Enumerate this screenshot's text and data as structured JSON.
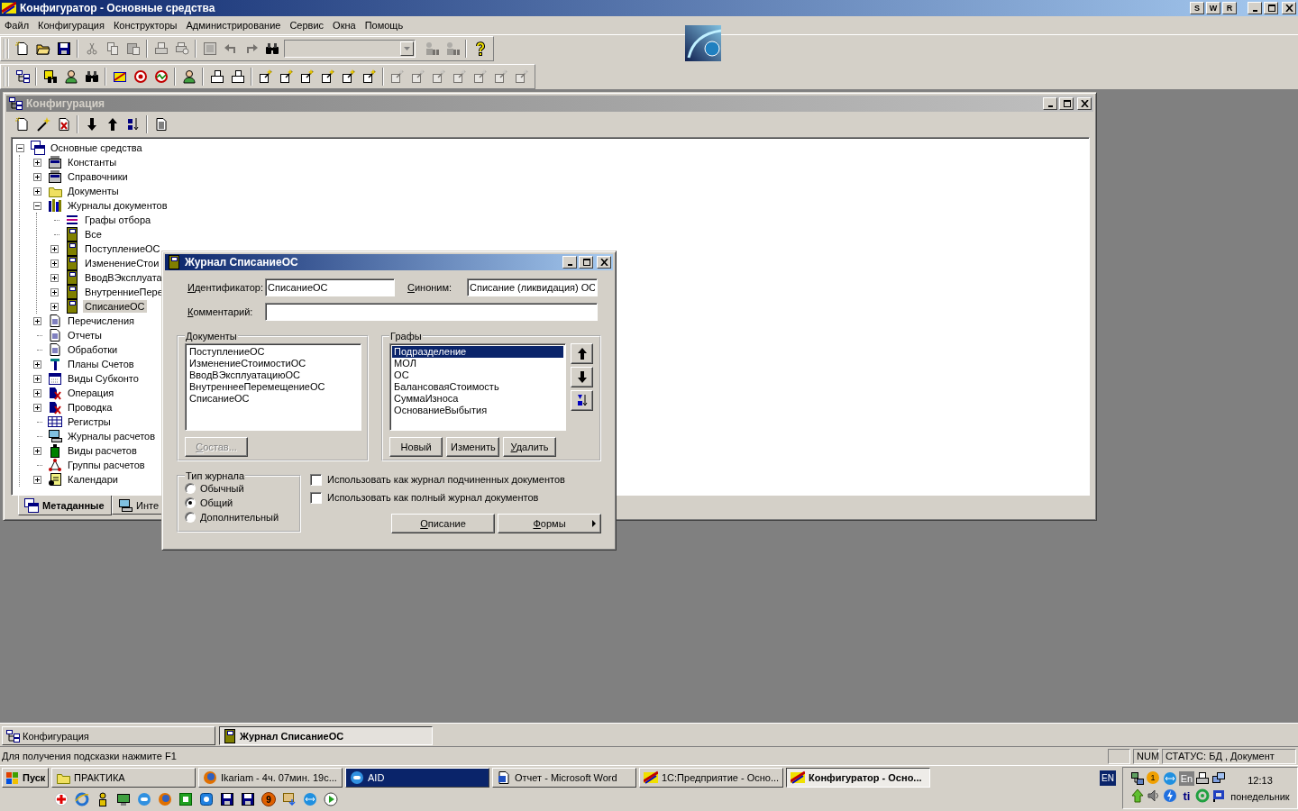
{
  "app_window": {
    "title": "Конфигуратор - Основные средства",
    "title_buttons": [
      "S",
      "W",
      "R"
    ]
  },
  "menu": [
    "Файл",
    "Конфигурация",
    "Конструкторы",
    "Администрирование",
    "Сервис",
    "Окна",
    "Помощь"
  ],
  "toolbar_rows": [
    [
      [
        {
          "kind": "button",
          "disabled": false
        },
        {
          "kind": "button",
          "disabled": false
        },
        {
          "kind": "button",
          "disabled": false
        }
      ],
      [
        {
          "kind": "button",
          "disabled": true
        },
        {
          "kind": "button",
          "disabled": true
        },
        {
          "kind": "button",
          "disabled": true
        }
      ],
      [
        {
          "kind": "button",
          "disabled": true
        },
        {
          "kind": "button",
          "disabled": true
        }
      ],
      [
        {
          "kind": "button",
          "disabled": true
        },
        {
          "kind": "button",
          "disabled": true
        },
        {
          "kind": "button",
          "disabled": true
        },
        {
          "kind": "button",
          "disabled": false
        },
        {
          "kind": "combo",
          "disabled": true
        },
        {
          "kind": "button",
          "disabled": true
        },
        {
          "kind": "button",
          "disabled": true
        }
      ],
      [
        {
          "kind": "button",
          "disabled": false
        }
      ]
    ],
    [
      [
        {
          "kind": "button",
          "disabled": false
        }
      ],
      [
        {
          "kind": "button",
          "disabled": false
        },
        {
          "kind": "button",
          "disabled": false
        },
        {
          "kind": "button",
          "disabled": false
        }
      ],
      [
        {
          "kind": "button",
          "disabled": false
        },
        {
          "kind": "button",
          "disabled": false
        },
        {
          "kind": "button",
          "disabled": false
        }
      ],
      [
        {
          "kind": "button",
          "disabled": false
        }
      ],
      [
        {
          "kind": "button",
          "disabled": false
        },
        {
          "kind": "button",
          "disabled": false
        }
      ],
      [
        {
          "kind": "button",
          "disabled": false
        },
        {
          "kind": "button",
          "disabled": false
        },
        {
          "kind": "button",
          "disabled": false
        },
        {
          "kind": "button",
          "disabled": false
        },
        {
          "kind": "button",
          "disabled": false
        },
        {
          "kind": "button",
          "disabled": false
        }
      ],
      [
        {
          "kind": "button",
          "disabled": true
        },
        {
          "kind": "button",
          "disabled": true
        },
        {
          "kind": "button",
          "disabled": true
        },
        {
          "kind": "button",
          "disabled": true
        },
        {
          "kind": "button",
          "disabled": true
        },
        {
          "kind": "button",
          "disabled": true
        },
        {
          "kind": "button",
          "disabled": true
        }
      ]
    ]
  ],
  "config_window": {
    "title": "Конфигурация",
    "active": false,
    "toolbar": [
      [
        {
          "disabled": false
        },
        {
          "disabled": false
        },
        {
          "disabled": false
        }
      ],
      [
        {
          "disabled": false
        },
        {
          "disabled": false
        },
        {
          "disabled": false
        }
      ],
      [
        {
          "disabled": false
        }
      ]
    ],
    "tree": [
      {
        "label": "Основные средства",
        "expanded": true,
        "selected": false,
        "children": [
          {
            "label": "Константы",
            "expanded": false,
            "selected": false
          },
          {
            "label": "Справочники",
            "expanded": false,
            "selected": false
          },
          {
            "label": "Документы",
            "expanded": false,
            "selected": false
          },
          {
            "label": "Журналы документов",
            "expanded": true,
            "selected": false,
            "children": [
              {
                "label": "Графы отбора",
                "selected": false
              },
              {
                "label": "Все",
                "selected": false
              },
              {
                "label": "ПоступлениеОС",
                "expanded": false,
                "selected": false
              },
              {
                "label": "ИзменениеСтои",
                "expanded": false,
                "selected": false
              },
              {
                "label": "ВводВЭксплуата",
                "expanded": false,
                "selected": false
              },
              {
                "label": "ВнутренниеПере",
                "expanded": false,
                "selected": false
              },
              {
                "label": "СписаниеОС",
                "expanded": false,
                "selected": true
              }
            ]
          },
          {
            "label": "Перечисления",
            "expanded": false,
            "selected": false
          },
          {
            "label": "Отчеты",
            "selected": false
          },
          {
            "label": "Обработки",
            "selected": false
          },
          {
            "label": "Планы Счетов",
            "expanded": false,
            "selected": false
          },
          {
            "label": "Виды Субконто",
            "expanded": false,
            "selected": false
          },
          {
            "label": "Операция",
            "expanded": false,
            "selected": false
          },
          {
            "label": "Проводка",
            "expanded": false,
            "selected": false
          },
          {
            "label": "Регистры",
            "selected": false
          },
          {
            "label": "Журналы расчетов",
            "selected": false
          },
          {
            "label": "Виды расчетов",
            "expanded": false,
            "selected": false
          },
          {
            "label": "Группы расчетов",
            "selected": false
          },
          {
            "label": "Календари",
            "expanded": false,
            "selected": false
          }
        ]
      }
    ],
    "tabs": [
      {
        "label": "Метаданные",
        "selected": true
      },
      {
        "label": "Инте",
        "selected": false
      }
    ]
  },
  "dialog": {
    "title": "Журнал СписаниеОС",
    "active": true,
    "identifier": {
      "label": "Идентификатор:",
      "value": "СписаниеОС"
    },
    "synonym": {
      "label": "Синоним:",
      "value": "Списание (ликвидация) ОС"
    },
    "comment": {
      "label": "Комментарий:"
    },
    "documents": {
      "title": "Документы",
      "items": [
        {
          "label": "ПоступлениеОС",
          "selected": false
        },
        {
          "label": "ИзменениеСтоимостиОС",
          "selected": false
        },
        {
          "label": "ВводВЭксплуатациюОС",
          "selected": false
        },
        {
          "label": "ВнутреннееПеремещениеОС",
          "selected": false
        },
        {
          "label": "СписаниеОС",
          "selected": false
        }
      ],
      "button": {
        "label": "Состав...",
        "disabled": true
      }
    },
    "columns": {
      "title": "Графы",
      "items": [
        {
          "label": "Подразделение",
          "selected": true
        },
        {
          "label": "МОЛ",
          "selected": false
        },
        {
          "label": "ОС",
          "selected": false
        },
        {
          "label": "БалансоваяСтоимость",
          "selected": false
        },
        {
          "label": "СуммаИзноса",
          "selected": false
        },
        {
          "label": "ОснованиеВыбытия",
          "selected": false
        }
      ],
      "buttons": [
        {
          "label": "Новый"
        },
        {
          "label": "Изменить"
        },
        {
          "label": "Удалить"
        }
      ]
    },
    "journal_type": {
      "title": "Тип журнала",
      "options": [
        {
          "label": "Обычный",
          "selected": false
        },
        {
          "label": "Общий",
          "selected": true
        },
        {
          "label": "Дополнительный",
          "selected": false
        }
      ]
    },
    "checkboxes": [
      {
        "label": "Использовать как журнал подчиненных документов",
        "checked": false
      },
      {
        "label": "Использовать как полный журнал  документов",
        "checked": false
      }
    ],
    "buttons": [
      {
        "label": "Описание",
        "menu": false
      },
      {
        "label": "Формы",
        "menu": true
      }
    ]
  },
  "mdi_tabs": [
    {
      "label": "Конфигурация",
      "selected": false
    },
    {
      "label": "Журнал СписаниеОС",
      "selected": true
    }
  ],
  "status_bar": {
    "hint": "Для получения подсказки нажмите F1",
    "panes": [
      "NUM",
      "СТАТУС: БД , Документ"
    ]
  },
  "taskbar": {
    "start": "Пуск",
    "tasks": [
      {
        "label": "ПРАКТИКА",
        "selected": false,
        "flashing": false
      },
      {
        "label": "Ikariam - 4ч. 07мин. 19с...",
        "selected": false,
        "flashing": false
      },
      {
        "label": "AID",
        "selected": false,
        "flashing": true
      },
      {
        "label": "Отчет - Microsoft Word",
        "selected": false,
        "flashing": false
      },
      {
        "label": "1С:Предприятие - Осно...",
        "selected": false,
        "flashing": false
      },
      {
        "label": "Конфигуратор - Осно...",
        "selected": true,
        "flashing": false
      }
    ],
    "quick_launch_badge": "9",
    "language": "EN",
    "tray": {
      "notification_count": "1",
      "texts": [
        "En",
        "ti"
      ],
      "time": "12:13",
      "day": "понедельник"
    }
  }
}
